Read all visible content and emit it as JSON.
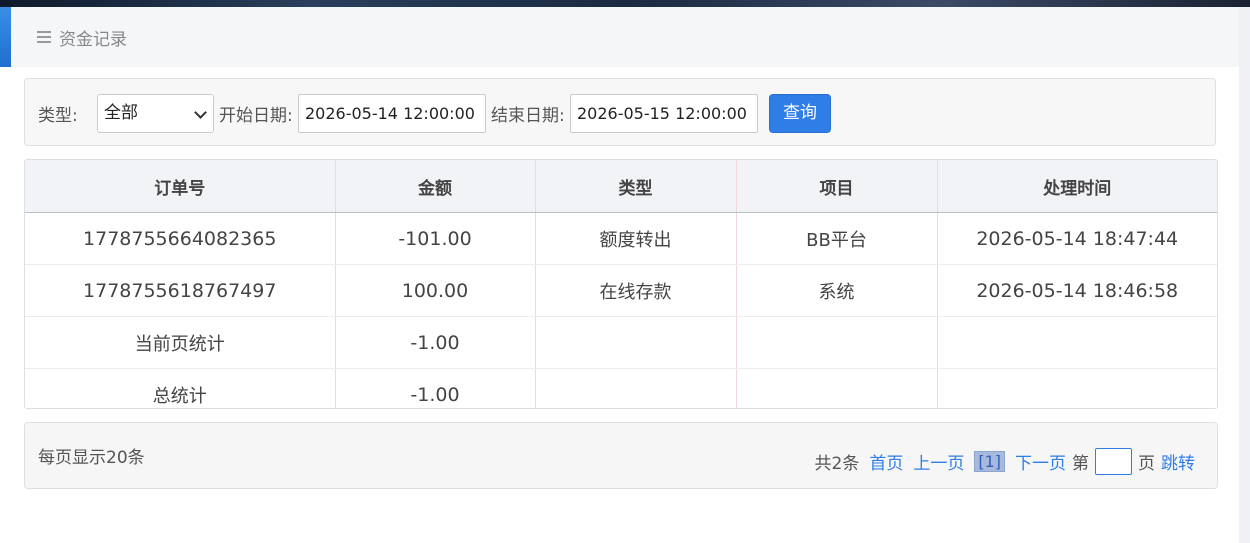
{
  "header": {
    "title": "资金记录",
    "icon": "menu-icon"
  },
  "filter": {
    "type_label": "类型:",
    "type_value": "全部",
    "start_label": "开始日期:",
    "start_value": "2026-05-14 12:00:00",
    "end_label": "结束日期:",
    "end_value": "2026-05-15 12:00:00",
    "query_label": "查询"
  },
  "table": {
    "headers": [
      "订单号",
      "金额",
      "类型",
      "项目",
      "处理时间"
    ],
    "rows": [
      [
        "1778755664082365",
        "-101.00",
        "额度转出",
        "BB平台",
        "2026-05-14 18:47:44"
      ],
      [
        "1778755618767497",
        "100.00",
        "在线存款",
        "系统",
        "2026-05-14 18:46:58"
      ],
      [
        "当前页统计",
        "-1.00",
        "",
        "",
        ""
      ],
      [
        "总统计",
        "-1.00",
        "",
        "",
        ""
      ]
    ]
  },
  "footer": {
    "per_page": "每页显示20条",
    "total": "共2条",
    "first": "首页",
    "prev": "上一页",
    "current": "[1]",
    "next": "下一页",
    "page_prefix": "第",
    "page_suffix": "页",
    "jump": "跳转"
  },
  "colors": {
    "primary": "#2f7ee8",
    "accent_left": "#3a8ee6"
  }
}
